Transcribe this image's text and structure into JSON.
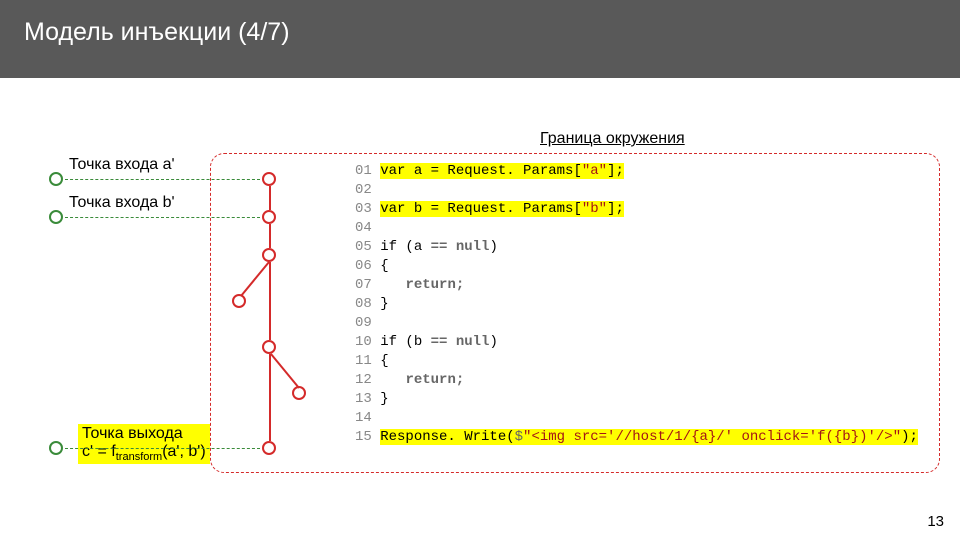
{
  "header": {
    "title": "Модель инъекции (4/7)"
  },
  "labels": {
    "boundary": "Граница окружения",
    "entry_a": "Точка входа aʹ",
    "entry_b": "Точка входа bʹ",
    "exit_line1": "Точка выхода",
    "exit_line2_pre": "cʹ = f",
    "exit_line2_sub": "transform",
    "exit_line2_post": "(aʹ, bʹ)"
  },
  "code": {
    "lines": [
      {
        "n": "01",
        "pre": "var a = Request. Params[",
        "str": "\"a\"",
        "post": "];",
        "hl_pre": true
      },
      {
        "n": "02",
        "pre": "",
        "str": "",
        "post": ""
      },
      {
        "n": "03",
        "pre": "var b = Request. Params[",
        "str": "\"b\"",
        "post": "];",
        "hl_pre": true
      },
      {
        "n": "04",
        "pre": "",
        "str": "",
        "post": ""
      },
      {
        "n": "05",
        "pre": "",
        "str": "",
        "post": "",
        "cond": "if (a == null)"
      },
      {
        "n": "06",
        "pre": "{",
        "str": "",
        "post": ""
      },
      {
        "n": "07",
        "pre": "   ",
        "str": "",
        "post": "",
        "ret": "return;"
      },
      {
        "n": "08",
        "pre": "}",
        "str": "",
        "post": ""
      },
      {
        "n": "09",
        "pre": "",
        "str": "",
        "post": ""
      },
      {
        "n": "10",
        "pre": "",
        "str": "",
        "post": "",
        "cond": "if (b == null)"
      },
      {
        "n": "11",
        "pre": "{",
        "str": "",
        "post": ""
      },
      {
        "n": "12",
        "pre": "   ",
        "str": "",
        "post": "",
        "ret": "return;"
      },
      {
        "n": "13",
        "pre": "}",
        "str": "",
        "post": ""
      },
      {
        "n": "14",
        "pre": "",
        "str": "",
        "post": ""
      },
      {
        "n": "15",
        "pre": "Response. Write(",
        "str": "",
        "post": ");",
        "interp": true,
        "interp_str": "\"<img src='//host/1/{a}/' onclick='f({b})'/>\"",
        "hl_pre": true,
        "hl_str": true
      }
    ]
  },
  "page_number": "13",
  "chart_data": {
    "type": "diagram",
    "title": "Модель инъекции (4/7)",
    "graph": {
      "external_nodes": [
        "entry_a_ext",
        "entry_b_ext",
        "exit_c_ext"
      ],
      "internal_nodes": [
        "n01",
        "n03",
        "n05",
        "n07",
        "n10",
        "n12",
        "n15"
      ],
      "edges_external": [
        {
          "from": "entry_a_ext",
          "to": "n01",
          "style": "green-dashed",
          "label": "Точка входа aʹ"
        },
        {
          "from": "entry_b_ext",
          "to": "n03",
          "style": "green-dashed",
          "label": "Точка входа bʹ"
        },
        {
          "from": "n15",
          "to": "exit_c_ext",
          "style": "green-dashed",
          "label": "Точка выхода cʹ = f_transform(aʹ, bʹ)"
        }
      ],
      "edges_internal": [
        {
          "from": "n01",
          "to": "n03"
        },
        {
          "from": "n03",
          "to": "n05"
        },
        {
          "from": "n05",
          "to": "n07"
        },
        {
          "from": "n05",
          "to": "n10"
        },
        {
          "from": "n10",
          "to": "n12"
        },
        {
          "from": "n10",
          "to": "n15"
        }
      ]
    },
    "code_listing": [
      "var a = Request.Params[\"a\"];",
      "",
      "var b = Request.Params[\"b\"];",
      "",
      "if (a == null)",
      "{",
      "   return;",
      "}",
      "",
      "if (b == null)",
      "{",
      "   return;",
      "}",
      "",
      "Response.Write($\"<img src='//host/1/{a}/' onclick='f({b})'/>\");"
    ],
    "highlighted_lines": [
      1,
      3,
      15
    ]
  }
}
